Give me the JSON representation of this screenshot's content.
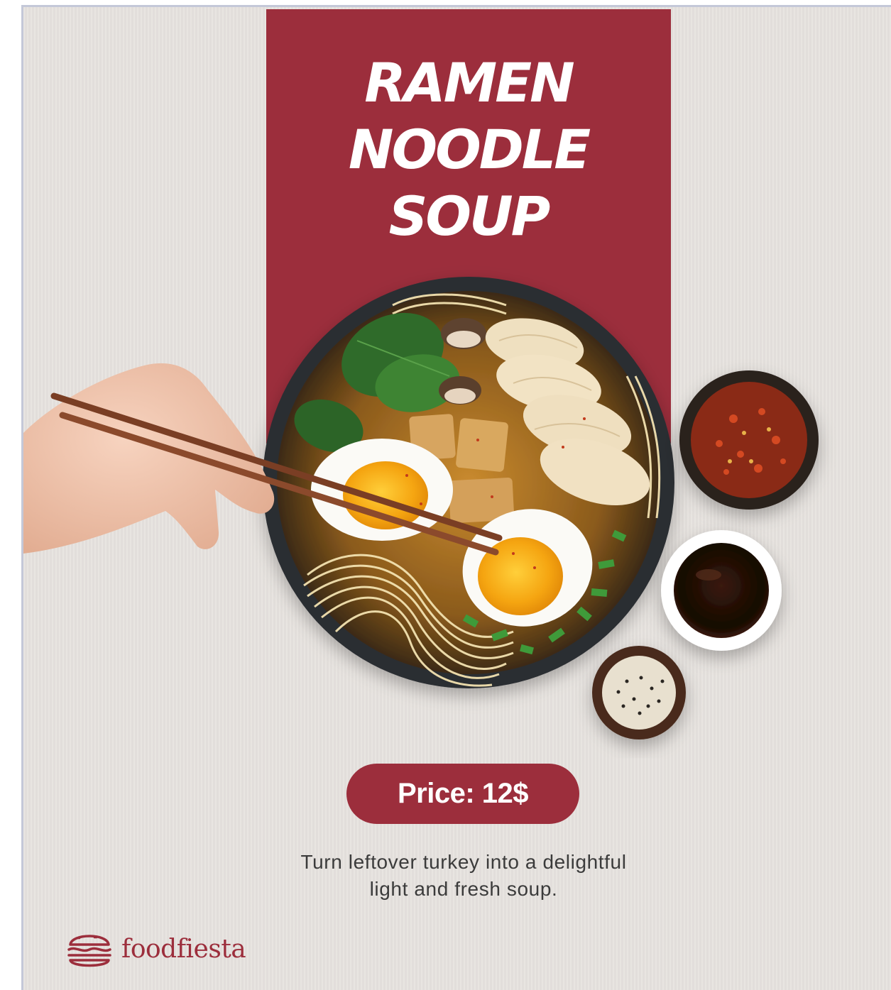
{
  "poster": {
    "title_lines": [
      "RAMEN",
      "NOODLE",
      "SOUP"
    ],
    "price": "Price: 12$",
    "description_lines": [
      "Turn leftover turkey into a delightful",
      "light and fresh soup."
    ],
    "brand": {
      "name": "foodfiesta",
      "logo_icon": "burger-icon"
    }
  },
  "colors": {
    "accent": "#9c2e3c",
    "background": "#e6e2de",
    "text": "#3b3b3b"
  }
}
